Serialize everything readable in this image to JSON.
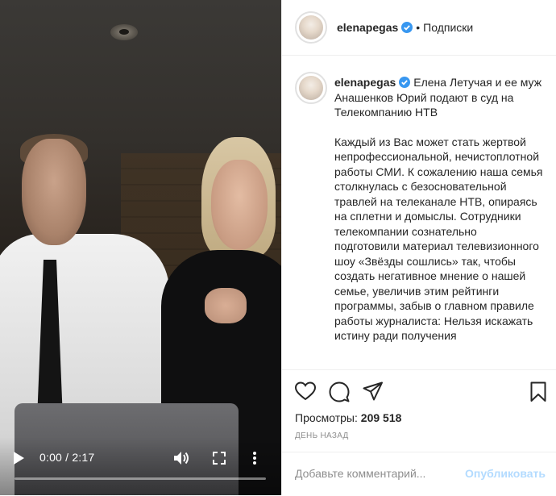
{
  "video": {
    "time_display": "0:00 / 2:17",
    "progress": 0.0,
    "icons": {
      "play": "play-icon",
      "volume": "volume-icon",
      "fullscreen": "fullscreen-icon",
      "more": "more-vertical-icon"
    }
  },
  "header": {
    "username": "elenapegas",
    "separator": "•",
    "follow_label": "Подписки"
  },
  "caption": {
    "username": "elenapegas",
    "title": "Елена Летучая и ее муж Анашенков Юрий подают в суд на Телекомпанию НТВ",
    "body": "Каждый из Вас может стать жертвой непрофессиональной, нечистоплотной работы СМИ. К сожалению наша семья столкнулась с безосновательной травлей на телеканале НТВ, опираясь на сплетни и домыслы. Сотрудники телекомпании сознательно подготовили материал телевизионного шоу «Звёзды сошлись» так, чтобы создать негативное мнение о нашей семье, увеличив этим рейтинги программы, забыв о главном правиле работы журналиста: Нельзя искажать истину ради получения"
  },
  "actions": {
    "icons": [
      "heart-icon",
      "comment-icon",
      "share-icon",
      "bookmark-icon"
    ]
  },
  "stats": {
    "views_label": "Просмотры:",
    "views_value": "209 518",
    "time_ago": "ДЕНЬ НАЗАД"
  },
  "comment": {
    "placeholder": "Добавьте комментарий...",
    "publish_label": "Опубликовать"
  },
  "colors": {
    "verified_blue": "#3897f0",
    "publish_disabled": "#b3dbff",
    "muted_text": "#8e8e8e"
  }
}
